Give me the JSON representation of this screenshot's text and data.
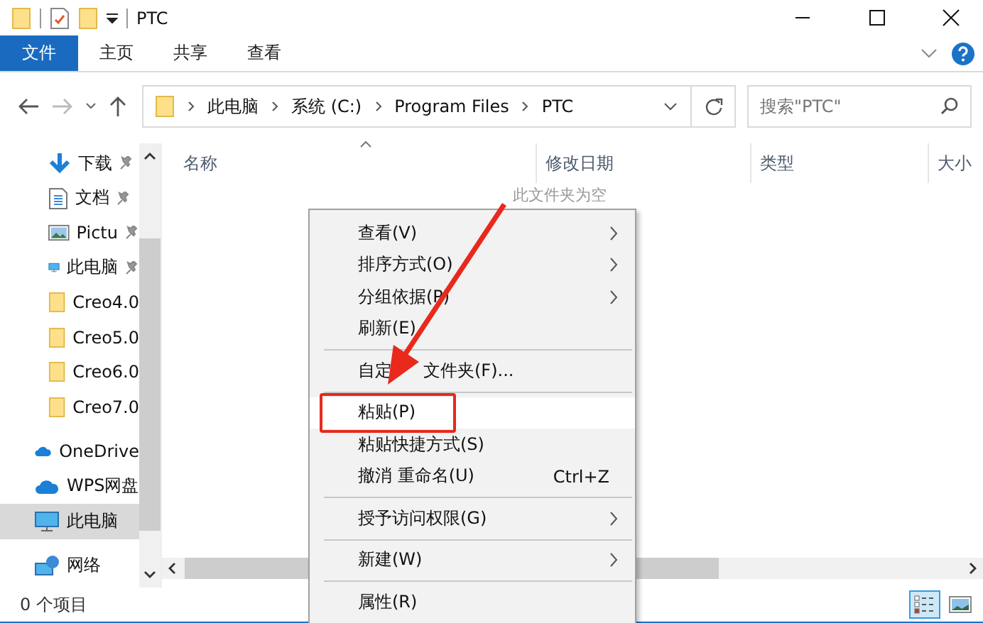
{
  "window": {
    "title": "PTC"
  },
  "ribbon": {
    "tabs": [
      {
        "label": "文件",
        "selected": true
      },
      {
        "label": "主页",
        "selected": false
      },
      {
        "label": "共享",
        "selected": false
      },
      {
        "label": "查看",
        "selected": false
      }
    ]
  },
  "address": {
    "crumbs": [
      "此电脑",
      "系统 (C:)",
      "Program Files",
      "PTC"
    ]
  },
  "search": {
    "placeholder": "搜索\"PTC\""
  },
  "sidebar": {
    "items": [
      {
        "label": "下载",
        "kind": "download",
        "pinned": true,
        "selected": false
      },
      {
        "label": "文档",
        "kind": "document",
        "pinned": true,
        "selected": false
      },
      {
        "label": "Pictu",
        "kind": "pictures",
        "pinned": true,
        "selected": false
      },
      {
        "label": "此电脑",
        "kind": "pc",
        "pinned": true,
        "selected": false
      },
      {
        "label": "Creo4.0",
        "kind": "folder",
        "pinned": false,
        "selected": false
      },
      {
        "label": "Creo5.0",
        "kind": "folder",
        "pinned": false,
        "selected": false
      },
      {
        "label": "Creo6.0",
        "kind": "folder",
        "pinned": false,
        "selected": false
      },
      {
        "label": "Creo7.0",
        "kind": "folder",
        "pinned": false,
        "selected": false
      },
      {
        "label": "OneDrive",
        "kind": "cloud",
        "pinned": false,
        "selected": false
      },
      {
        "label": "WPS网盘",
        "kind": "cloud",
        "pinned": false,
        "selected": false
      },
      {
        "label": "此电脑",
        "kind": "pc",
        "pinned": false,
        "selected": true
      },
      {
        "label": "网络",
        "kind": "network",
        "pinned": false,
        "selected": false
      }
    ]
  },
  "table": {
    "columns": [
      "名称",
      "修改日期",
      "类型",
      "大小"
    ],
    "empty_text": "此文件夹为空"
  },
  "context_menu": {
    "items": [
      {
        "kind": "item",
        "label": "查看(V)",
        "submenu": true,
        "selected": false
      },
      {
        "kind": "item",
        "label": "排序方式(O)",
        "submenu": true,
        "selected": false
      },
      {
        "kind": "item",
        "label": "分组依据(P)",
        "submenu": true,
        "selected": false
      },
      {
        "kind": "item",
        "label": "刷新(E)",
        "submenu": false,
        "selected": false
      },
      {
        "kind": "separator"
      },
      {
        "kind": "item",
        "label": "自定",
        "label_after_arrow": "文件夹(F)...",
        "submenu": false,
        "selected": false
      },
      {
        "kind": "separator"
      },
      {
        "kind": "item",
        "label": "粘贴(P)",
        "submenu": false,
        "selected": true
      },
      {
        "kind": "item",
        "label": "粘贴快捷方式(S)",
        "submenu": false,
        "selected": false
      },
      {
        "kind": "item",
        "label": "撤消 重命名(U)",
        "shortcut": "Ctrl+Z",
        "submenu": false,
        "selected": false
      },
      {
        "kind": "separator"
      },
      {
        "kind": "item",
        "label": "授予访问权限(G)",
        "submenu": true,
        "selected": false
      },
      {
        "kind": "separator"
      },
      {
        "kind": "item",
        "label": "新建(W)",
        "submenu": true,
        "selected": false
      },
      {
        "kind": "separator"
      },
      {
        "kind": "item",
        "label": "属性(R)",
        "submenu": false,
        "selected": false
      }
    ]
  },
  "status_bar": {
    "count": "0 个项目"
  }
}
